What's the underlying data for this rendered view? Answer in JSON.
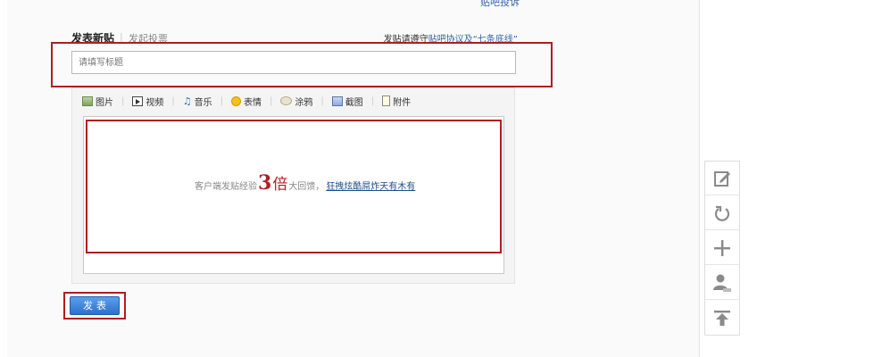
{
  "top": {
    "link_text": "贴吧投诉"
  },
  "composer": {
    "title": "发表新贴",
    "separator": "|",
    "vote_label": "发起投票",
    "rules_prefix": "发贴请遵守",
    "rules_link": "贴吧协议及“七条底线”",
    "title_placeholder": "请填写标题"
  },
  "toolbar": {
    "items": [
      {
        "label": "图片",
        "icon": "image-icon"
      },
      {
        "label": "视频",
        "icon": "video-icon"
      },
      {
        "label": "音乐",
        "icon": "music-icon"
      },
      {
        "label": "表情",
        "icon": "emoji-icon"
      },
      {
        "label": "涂鸦",
        "icon": "doodle-icon"
      },
      {
        "label": "截图",
        "icon": "screenshot-icon"
      },
      {
        "label": "附件",
        "icon": "attachment-icon"
      }
    ],
    "separator": "|"
  },
  "promo": {
    "prefix": "客户端发贴经验",
    "multiplier": "3",
    "unit": "倍",
    "suffix": "大回馈，",
    "link": "狂拽炫酷屌炸天有木有"
  },
  "submit": {
    "label": "发表"
  },
  "side_toolbar": {
    "buttons": [
      "edit-icon",
      "refresh-icon",
      "add-icon",
      "user-icon",
      "back-to-top-icon"
    ]
  },
  "colors": {
    "highlight": "#b01d22",
    "link": "#3366aa",
    "button_top": "#5aa0ea",
    "button_bottom": "#2d6fcf",
    "promo_red": "#b01d22"
  }
}
